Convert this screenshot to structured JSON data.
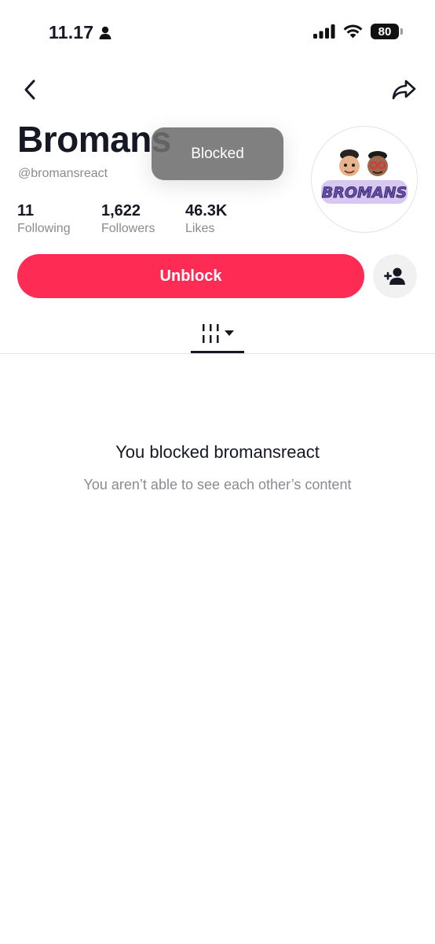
{
  "status_bar": {
    "time": "11.17",
    "battery": "80"
  },
  "profile": {
    "display_name": "Bromans",
    "username": "@bromansreact",
    "avatar_text": "BROMANS",
    "stats": [
      {
        "value": "11",
        "label": "Following"
      },
      {
        "value": "1,622",
        "label": "Followers"
      },
      {
        "value": "46.3K",
        "label": "Likes"
      }
    ]
  },
  "toast": {
    "message": "Blocked"
  },
  "actions": {
    "unblock_label": "Unblock"
  },
  "tabs": {
    "active": "videos-grid"
  },
  "empty_state": {
    "title": "You blocked bromansreact",
    "subtitle": "You aren’t able to see each other’s content"
  },
  "colors": {
    "accent": "#fe2c55",
    "secondary_text": "#8a8b91",
    "toast_bg": "#6e6e6e"
  }
}
